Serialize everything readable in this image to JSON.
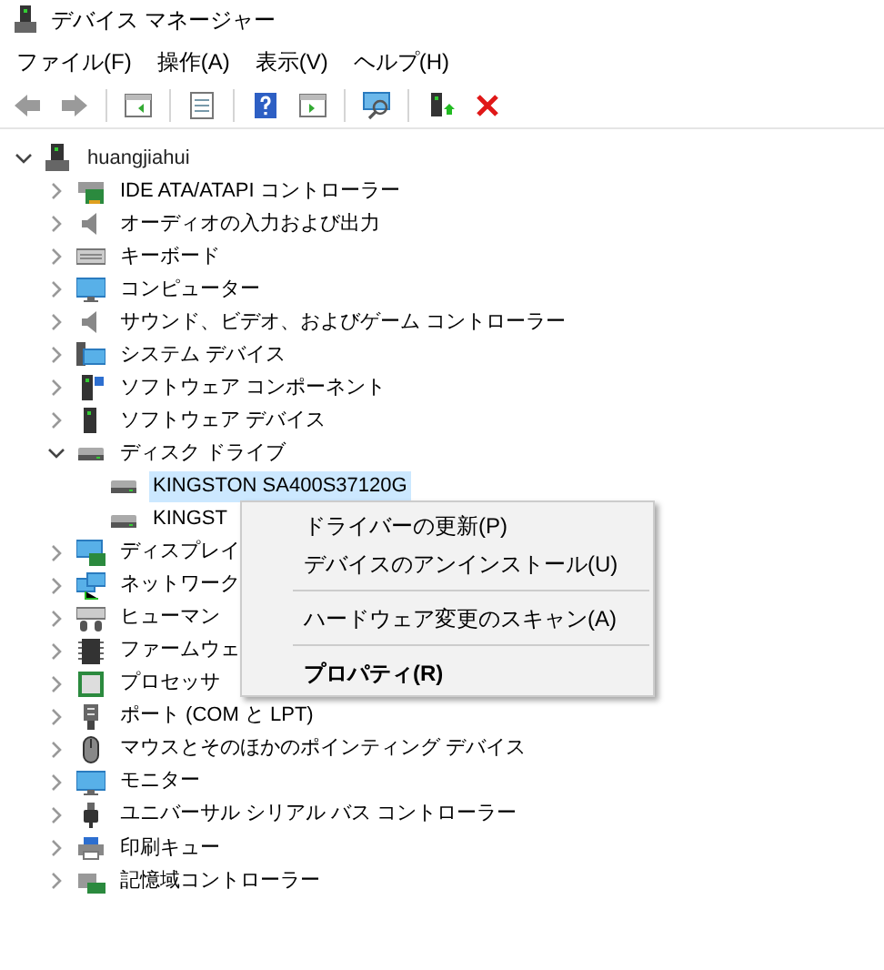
{
  "window": {
    "title": "デバイス マネージャー"
  },
  "menu_bar": [
    {
      "label": "ファイル(F)"
    },
    {
      "label": "操作(A)"
    },
    {
      "label": "表示(V)"
    },
    {
      "label": "ヘルプ(H)"
    }
  ],
  "tree": {
    "label": "huangjiahui",
    "expanded": true,
    "selected": false,
    "children": [
      {
        "label": "IDE ATA/ATAPI コントローラー",
        "expanded": false,
        "selected": false
      },
      {
        "label": "オーディオの入力および出力",
        "expanded": false,
        "selected": false
      },
      {
        "label": "キーボード",
        "expanded": false,
        "selected": false
      },
      {
        "label": "コンピューター",
        "expanded": false,
        "selected": false
      },
      {
        "label": "サウンド、ビデオ、およびゲーム コントローラー",
        "expanded": false,
        "selected": false
      },
      {
        "label": "システム デバイス",
        "expanded": false,
        "selected": false
      },
      {
        "label": "ソフトウェア コンポーネント",
        "expanded": false,
        "selected": false
      },
      {
        "label": "ソフトウェア デバイス",
        "expanded": false,
        "selected": false
      },
      {
        "label": "ディスク ドライブ",
        "expanded": true,
        "selected": false,
        "children": [
          {
            "label": "KINGSTON SA400S37120G",
            "selected": true
          },
          {
            "label": "KINGST",
            "selected": false
          }
        ]
      },
      {
        "label": "ディスプレイ",
        "expanded": false,
        "selected": false
      },
      {
        "label": "ネットワーク",
        "expanded": false,
        "selected": false
      },
      {
        "label": "ヒューマン",
        "expanded": false,
        "selected": false
      },
      {
        "label": "ファームウェ",
        "expanded": false,
        "selected": false
      },
      {
        "label": "プロセッサ",
        "expanded": false,
        "selected": false
      },
      {
        "label": "ポート (COM と LPT)",
        "expanded": false,
        "selected": false
      },
      {
        "label": "マウスとそのほかのポインティング デバイス",
        "expanded": false,
        "selected": false
      },
      {
        "label": "モニター",
        "expanded": false,
        "selected": false
      },
      {
        "label": "ユニバーサル シリアル バス コントローラー",
        "expanded": false,
        "selected": false
      },
      {
        "label": "印刷キュー",
        "expanded": false,
        "selected": false
      },
      {
        "label": "記憶域コントローラー",
        "expanded": false,
        "selected": false
      }
    ]
  },
  "context_menu": {
    "items": [
      {
        "kind": "item",
        "label": "ドライバーの更新(P)"
      },
      {
        "kind": "item",
        "label": "デバイスのアンインストール(U)"
      },
      {
        "kind": "separator"
      },
      {
        "kind": "item",
        "label": "ハードウェア変更のスキャン(A)"
      },
      {
        "kind": "separator"
      },
      {
        "kind": "default",
        "label": "プロパティ(R)"
      }
    ]
  }
}
